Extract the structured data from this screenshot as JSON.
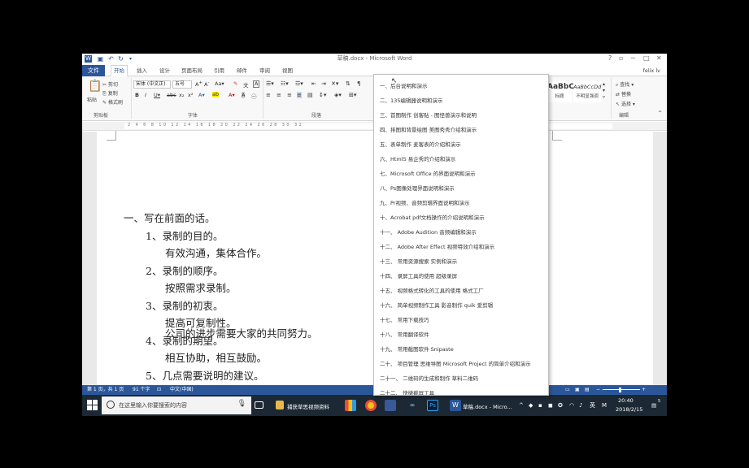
{
  "window": {
    "title": "草稿.docx - Microsoft Word",
    "help": "?",
    "minimize": "─",
    "maximize": "□",
    "close": "✕",
    "user": "felix lv"
  },
  "tabs": [
    "文件",
    "开始",
    "插入",
    "设计",
    "页面布局",
    "引用",
    "邮件",
    "审阅",
    "视图"
  ],
  "ribbon": {
    "paste": "粘贴",
    "cut": "剪切",
    "copy": "复制",
    "format_painter": "格式刷",
    "clipboard_group": "剪贴板",
    "font_name": "宋体 (中文正)",
    "font_size": "五号",
    "font_group": "字体",
    "paragraph_group": "段落",
    "styles": [
      {
        "sample": "AaBbC",
        "name": "标题"
      },
      {
        "sample": "AaBbCcDd",
        "name": "不明显强调"
      }
    ],
    "find": "查找",
    "replace": "替换",
    "select": "选择",
    "editing_group": "编辑"
  },
  "ruler_numbers": "2 4 6 8 10 12 14 16 18 20 22 24 26 28 30 32",
  "document": {
    "lines": [
      "一、写在前面的话。",
      "1、录制的目的。",
      "有效沟通，集体合作。",
      "2、录制的顺序。",
      "按照需求录制。",
      "3、录制的初衷。",
      "提高可复制性。",
      "4、录制的期望。",
      "相互协助，相互鼓励。",
      "5、几点需要说明的建议。",
      "公司的进步需要大家的共同努力。"
    ]
  },
  "menu_items": [
    "一、后台说明和演示",
    "二、135编辑器说明和演示",
    "三、首图制作 创客贴 - 图怪兽演示和说明",
    "四、排图和背景绘图 美图秀秀介绍和演示",
    "五、表单制作 麦客表的介绍和演示",
    "六、Html5 易企秀的介绍和演示",
    "七、Microsoft Office 的界面说明和演示",
    "八、Ps图像处理界面说明和演示",
    "九、Pr视频、音频剪辑界面说明和演示",
    "十、Acrobat pdf文档操作的介绍说明和演示",
    "十一、   Adobe Audition 音频编辑和演示",
    "十二、   Adobe After Effect 视频特效介绍和演示",
    "十三、   常用资源搜索 实例和演示",
    "十四、   录屏工具的使用 超级录屏",
    "十五、   视频格式转化的工具的使用 格式工厂",
    "十六、   简单视频制作工具 影音制作 quik 爱剪辑",
    "十七、   常用下载技巧",
    "十八、   常用翻译软件",
    "十九、   常用截图软件 Snipaste",
    "二十、   项目管理 思维导图 Microsoft Project 的简单介绍和演示",
    "二十一、      二维码的生成和制作  草料二维码",
    "二十二、      快捷截屏工具"
  ],
  "status": {
    "page": "第 1 页，共 1 页",
    "words": "91 个字",
    "language": "中文(中国)",
    "zoom_minus": "−",
    "zoom_plus": "+"
  },
  "taskbar": {
    "search_placeholder": "在这里输入你要搜索的内容",
    "folder_label": "捕获草思视频资料",
    "word_label": "草稿.docx - Micro...",
    "ime": "英",
    "ime2": "M",
    "time": "20:40",
    "date": "2018/2/15",
    "notif_count": "5"
  },
  "colors": {
    "word_blue": "#2b579a",
    "taskbar": "#1c2833"
  }
}
